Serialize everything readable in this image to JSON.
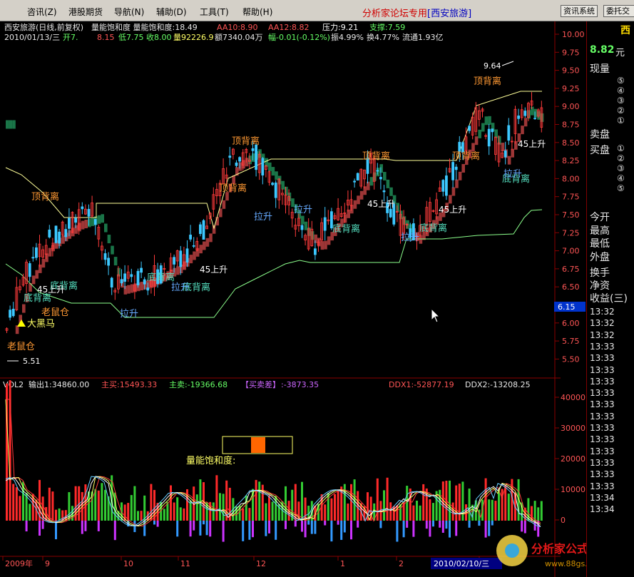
{
  "menu": {
    "items": [
      "咨讯(Z)",
      "港股期货",
      "导航(N)",
      "辅助(D)",
      "工具(T)",
      "帮助(H)"
    ],
    "forum_title": "分析家论坛专用",
    "stock_tag": "[西安旅游]",
    "btn_info": "资讯系统",
    "btn_trade": "委托交"
  },
  "header": {
    "line1": "西安旅游(日线,前复权)",
    "indicator_label": "量能饱和度 量能饱和度:18.49",
    "aa10": "AA10:8.90",
    "aa12": "AA12:8.82",
    "pressure": "压力:9.21",
    "support": "支撑:7.59",
    "line2_date": "2010/01/13/三",
    "open": "开7.",
    "high": "8.15",
    "low": "低7.75",
    "close": "收8.00",
    "volume": "量92226.9",
    "amount": "额7340.04万",
    "change": "幅-0.01(-0.12%)",
    "amplitude": "振4.99%",
    "turnover": "换4.77%",
    "float": "流通1.93亿"
  },
  "annotations": {
    "top_div": "顶背离",
    "bottom_div": "底背离",
    "rise45": "45上升",
    "pull_up": "拉升",
    "rat": "老鼠仓",
    "black_horse": "大黑马",
    "high_mark": "9.64",
    "low_mark": "5.51",
    "saturation_label": "量能饱和度:"
  },
  "vol_header": {
    "name": "VOL2",
    "output": "输出1:34860.00",
    "main_buy": "主买:15493.33",
    "main_sell": "主卖:-19366.68",
    "buy_sell_diff_label": "【买卖差】",
    "buy_sell_diff": ":-3873.35",
    "ddx1": "DDX1:-52877.19",
    "ddx2": "DDX2:-13208.25"
  },
  "price_axis": [
    "10.00",
    "9.75",
    "9.50",
    "9.25",
    "9.00",
    "8.75",
    "8.50",
    "8.25",
    "8.00",
    "7.75",
    "7.50",
    "7.25",
    "7.00",
    "6.75",
    "6.50",
    "6.25",
    "6.00",
    "5.75",
    "5.50"
  ],
  "vol_axis": [
    "40000",
    "30000",
    "20000",
    "10000",
    "0"
  ],
  "cursor_price": "6.15",
  "date_axis": [
    "2009年",
    "9",
    "10",
    "11",
    "12",
    "1",
    "2",
    "3"
  ],
  "date_cursor": "2010/02/10/三",
  "right_panel": {
    "name": "西",
    "price": "8.82",
    "unit": "元",
    "labels": [
      "现量",
      "卖盘",
      "买盘",
      "今开",
      "最高",
      "最低",
      "外盘",
      "换手",
      "净资",
      "收益(三)"
    ],
    "levels": [
      "⑤",
      "④",
      "③",
      "②",
      "①"
    ],
    "times": [
      "13:32",
      "13:32",
      "13:32",
      "13:33",
      "13:33",
      "13:33",
      "13:33",
      "13:33",
      "13:33",
      "13:33",
      "13:33",
      "13:33",
      "13:33",
      "13:33",
      "13:33",
      "13:33",
      "13:34",
      "13:34"
    ]
  },
  "watermark": {
    "cn": "分析家公式网",
    "url": "www.88gs.com"
  },
  "colors": {
    "up": "#ff3b3b",
    "down": "#3cc8ff",
    "ribbon_up": "#b84040",
    "ribbon_down": "#1f8a55",
    "yellow": "#ffff66",
    "green": "#66ff66",
    "magenta": "#ff66ff",
    "orange": "#ffaa00"
  }
}
